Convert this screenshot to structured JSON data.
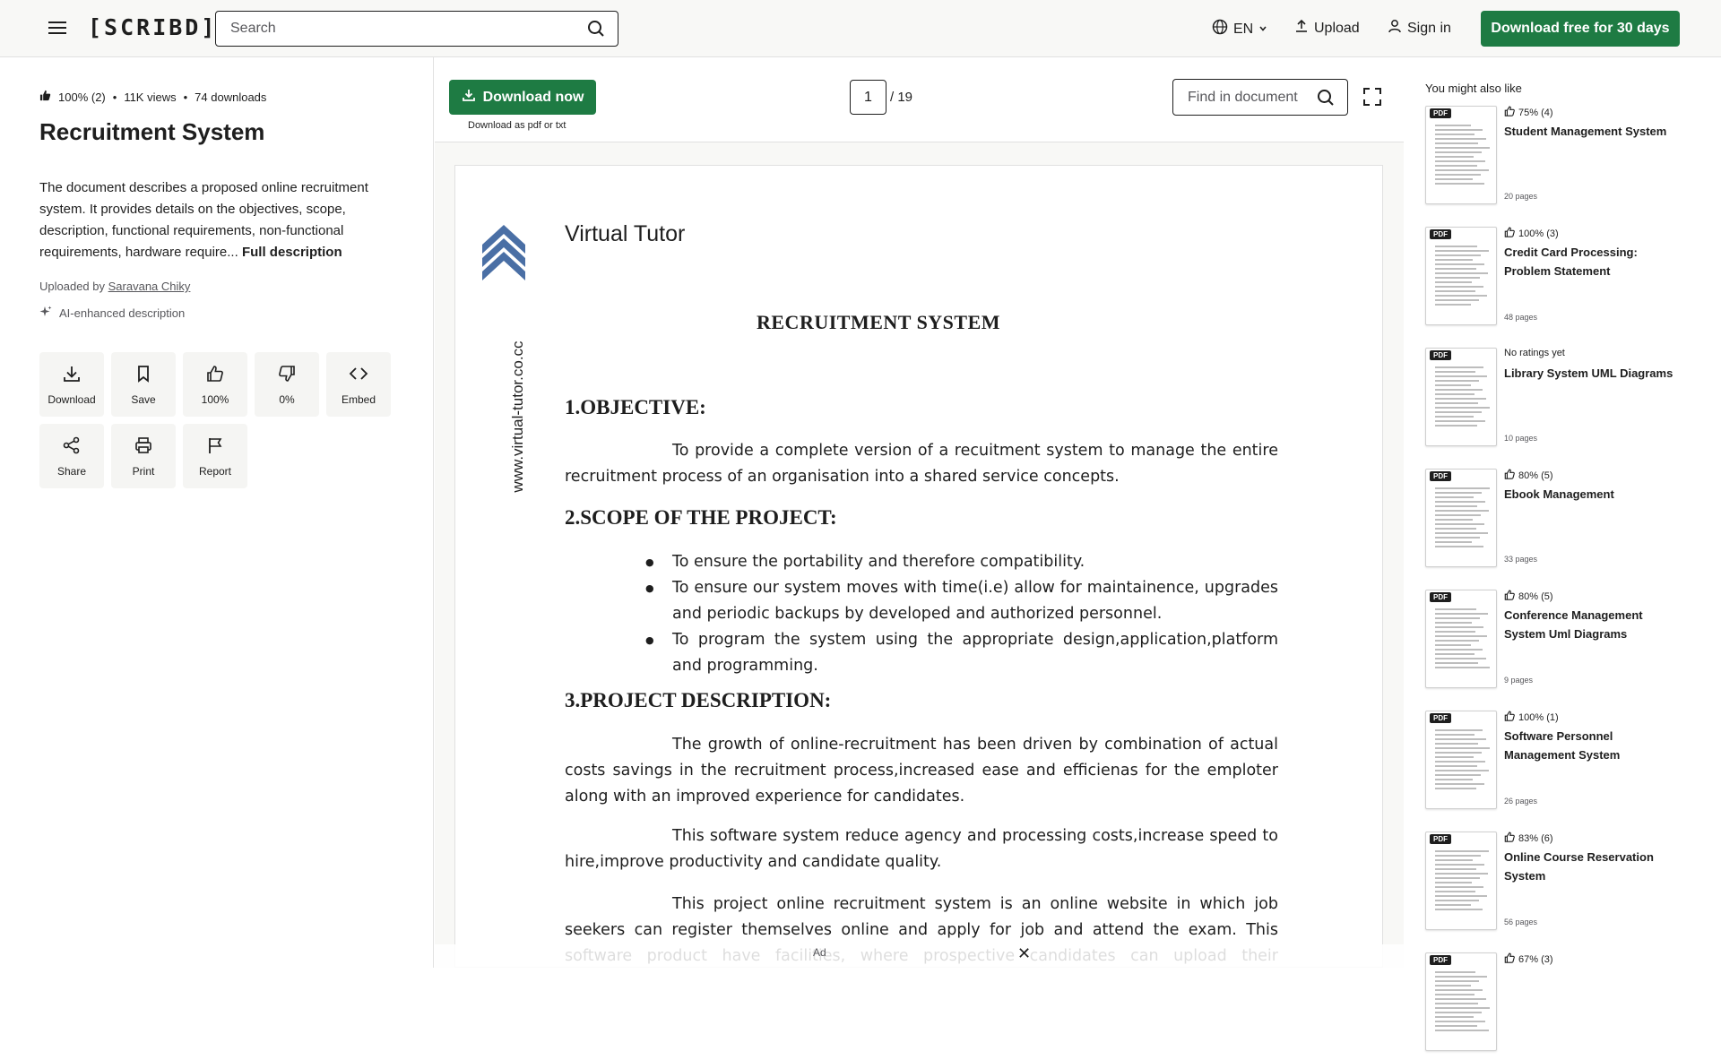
{
  "header": {
    "logo": "[SCRIBD]",
    "search_placeholder": "Search",
    "lang": "EN",
    "upload": "Upload",
    "signin": "Sign in",
    "cta": "Download free for 30 days"
  },
  "meta": {
    "rating": "100% (2)",
    "views": "11K views",
    "downloads": "74 downloads",
    "title": "Recruitment System",
    "description": "The document describes a proposed online recruitment system. It provides details on the objectives, scope, description, functional requirements, non-functional requirements, hardware require...",
    "full_description": "Full description",
    "uploaded_by_label": "Uploaded by",
    "uploader": "Saravana Chiky",
    "ai_label": "AI-enhanced description"
  },
  "actions": [
    {
      "label": "Download",
      "icon": "download-icon"
    },
    {
      "label": "Save",
      "icon": "bookmark-icon"
    },
    {
      "label": "100%",
      "icon": "thumbs-up-icon"
    },
    {
      "label": "0%",
      "icon": "thumbs-down-icon"
    },
    {
      "label": "Embed",
      "icon": "code-icon"
    },
    {
      "label": "Share",
      "icon": "share-icon"
    },
    {
      "label": "Print",
      "icon": "print-icon"
    },
    {
      "label": "Report",
      "icon": "flag-icon"
    }
  ],
  "viewer": {
    "download_now": "Download now",
    "download_sub": "Download as pdf or txt",
    "page_current": "1",
    "page_total": "/ 19",
    "find_placeholder": "Find in document",
    "ad_label": "Ad",
    "ad_close": "✕"
  },
  "document": {
    "side_url": "www.virtual-tutor.co.cc",
    "brand": "Virtual Tutor",
    "title": "RECRUITMENT SYSTEM",
    "h1": "1.OBJECTIVE:",
    "p1": "To provide a complete version of a recuitment system to manage the entire recruitment process of an organisation into a shared service concepts.",
    "h2": "2.SCOPE OF THE PROJECT:",
    "bullets": [
      "To ensure the portability and therefore compatibility.",
      "To ensure our system moves with time(i.e) allow for maintainence, upgrades and periodic backups by developed and authorized personnel.",
      "To program the system using the appropriate design,application,platform and programming."
    ],
    "h3": "3.PROJECT DESCRIPTION:",
    "p2": "The growth of online-recruitment has been driven by combination of actual costs savings in the recruitment process,increased ease and efficienas for the emploter along with an improved experience for candidates.",
    "p3": "This software system reduce agency and processing costs,increase speed to hire,improve productivity and candidate quality.",
    "p4": "This project online recruitment system is an online website in which job seekers can register themselves online and apply for job and attend the exam. This software product have facilities, where prospective candidates can upload their curriculum vita and apply for jobs"
  },
  "related": {
    "title": "You might also like",
    "items": [
      {
        "rating": "75% (4)",
        "title": "Student Management System",
        "pages": "20 pages"
      },
      {
        "rating": "100% (3)",
        "title": "Credit Card Processing: Problem Statement",
        "pages": "48 pages"
      },
      {
        "rating": "No ratings yet",
        "title": "Library System UML Diagrams",
        "pages": "10 pages"
      },
      {
        "rating": "80% (5)",
        "title": "Ebook Management",
        "pages": "33 pages"
      },
      {
        "rating": "80% (5)",
        "title": "Conference Management System Uml Diagrams",
        "pages": "9 pages"
      },
      {
        "rating": "100% (1)",
        "title": "Software Personnel Management System",
        "pages": "26 pages"
      },
      {
        "rating": "83% (6)",
        "title": "Online Course Reservation System",
        "pages": "56 pages"
      },
      {
        "rating": "67% (3)",
        "title": "",
        "pages": ""
      }
    ]
  },
  "colors": {
    "brand_green": "#1e7b43",
    "text": "#1e1e1e",
    "muted": "#57575b",
    "chevron_blue": "#4a6fa5"
  }
}
